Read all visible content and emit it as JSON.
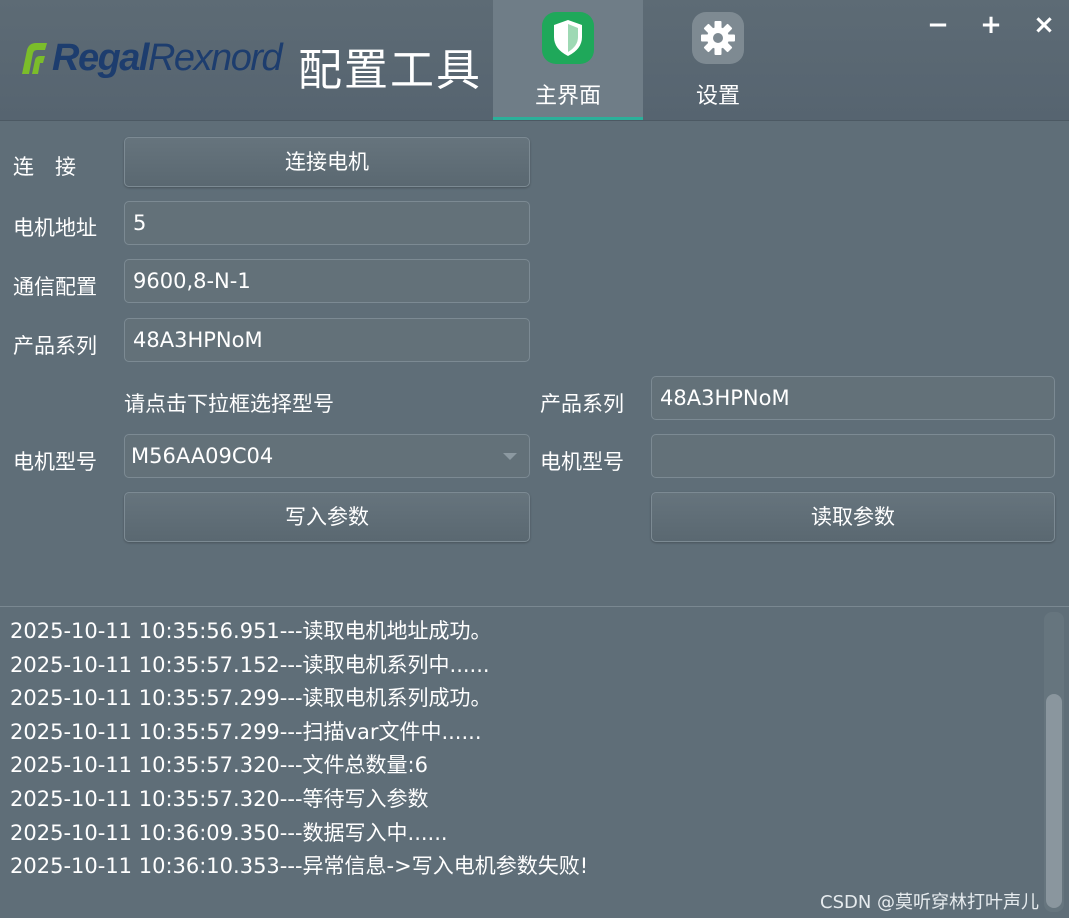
{
  "header": {
    "logo_part1": "Regal",
    "logo_part2": "Rexnord",
    "app_title": "配置工具",
    "tabs": [
      {
        "label": "主界面",
        "icon": "shield-icon",
        "active": true
      },
      {
        "label": "设置",
        "icon": "gear-icon",
        "active": false
      }
    ],
    "window_controls": {
      "minimize": "−",
      "maximize": "+",
      "close": "×"
    }
  },
  "colors": {
    "background": "#5f6e78",
    "accent_green": "#2bb09a",
    "shield_green": "#1fa85a",
    "logo_blue": "#1d3d6e",
    "logo_green": "#7bbd2a"
  },
  "form": {
    "connect_label": "连　接",
    "connect_button": "连接电机",
    "address_label": "电机地址",
    "address_value": "5",
    "comm_label": "通信配置",
    "comm_value": "9600,8-N-1",
    "series_label": "产品系列",
    "series_value": "48A3HPNoM",
    "select_hint": "请点击下拉框选择型号",
    "model_label": "电机型号",
    "model_value": "M56AA09C04",
    "write_button": "写入参数",
    "read_series_label": "产品系列",
    "read_series_value": "48A3HPNoM",
    "read_model_label": "电机型号",
    "read_model_value": "",
    "read_button": "读取参数"
  },
  "log": {
    "lines": [
      "2025-10-11 10:35:56.951---读取电机地址成功。",
      "2025-10-11 10:35:57.152---读取电机系列中......",
      "2025-10-11 10:35:57.299---读取电机系列成功。",
      "2025-10-11 10:35:57.299---扫描var文件中......",
      "2025-10-11 10:35:57.320---文件总数量:6",
      "2025-10-11 10:35:57.320---等待写入参数",
      "2025-10-11 10:36:09.350---数据写入中......",
      "2025-10-11 10:36:10.353---异常信息->写入电机参数失败!"
    ]
  },
  "watermark": "CSDN @莫听穿林打叶声儿"
}
